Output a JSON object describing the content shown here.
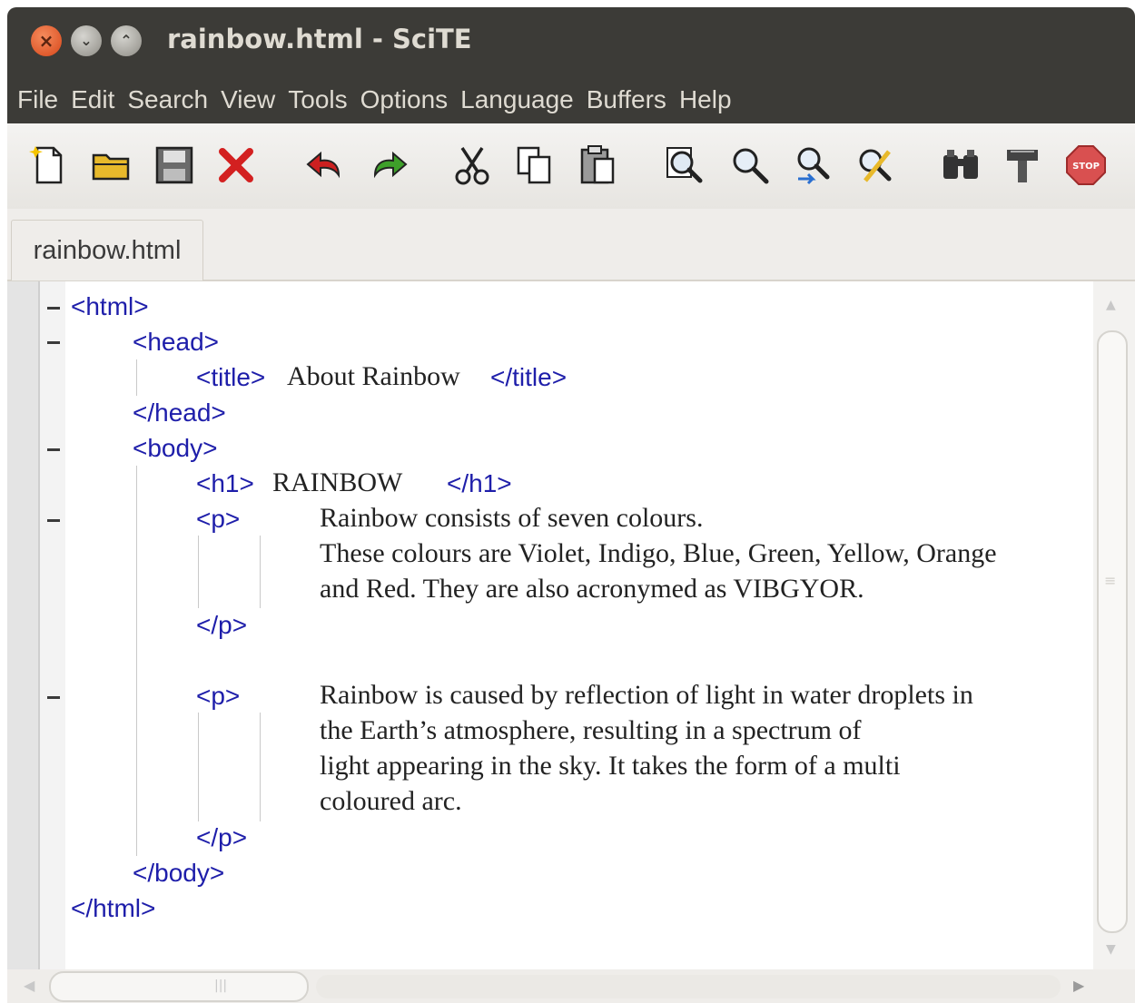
{
  "window": {
    "title": "rainbow.html - SciTE"
  },
  "menu": [
    "File",
    "Edit",
    "Search",
    "View",
    "Tools",
    "Options",
    "Language",
    "Buffers",
    "Help"
  ],
  "toolbar": [
    "new-file-icon",
    "open-folder-icon",
    "save-icon",
    "close-file-icon",
    "undo-icon",
    "redo-icon",
    "cut-icon",
    "copy-icon",
    "paste-icon",
    "find-icon",
    "find-next-icon",
    "find-in-files-icon",
    "replace-icon",
    "compile-icon",
    "build-icon",
    "stop-icon"
  ],
  "tabs": [
    {
      "label": "rainbow.html"
    }
  ],
  "code": {
    "html_open": "<html>",
    "head_open": "<head>",
    "title_open": "<title>",
    "title_text": "About Rainbow",
    "title_close": "</title>",
    "head_close": "</head>",
    "body_open": "<body>",
    "h1_open": "<h1>",
    "h1_text": "RAINBOW",
    "h1_close": "</h1>",
    "p1_open": "<p>",
    "p1_lines": [
      "Rainbow consists of seven colours.",
      "These colours are Violet, Indigo, Blue, Green, Yellow, Orange",
      "and Red. They are also acronymed as VIBGYOR."
    ],
    "p1_close": "</p>",
    "p2_open": "<p>",
    "p2_lines": [
      "Rainbow is caused by reflection of light in water droplets in",
      "the Earth’s atmosphere, resulting in a spectrum of",
      "light appearing in the sky. It takes the form of a multi",
      "coloured arc."
    ],
    "p2_close": "</p>",
    "body_close": "</body>",
    "html_close": "</html>"
  },
  "colors": {
    "tag": "#1e1eaa",
    "text": "#222222",
    "titlebar": "#3c3b37"
  }
}
